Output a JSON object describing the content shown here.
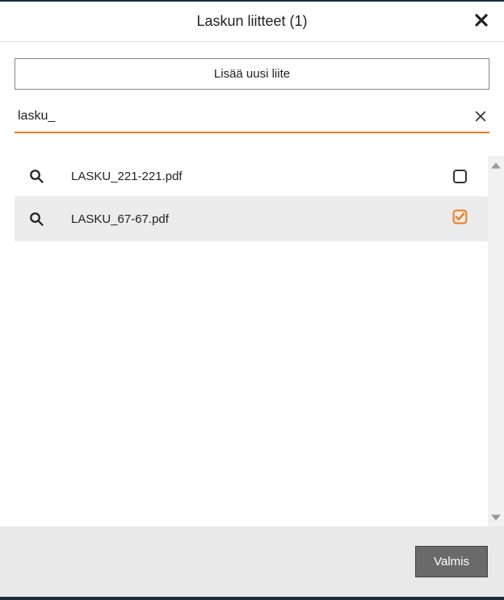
{
  "header": {
    "title": "Laskun liitteet (1)"
  },
  "actions": {
    "add_label": "Lisää uusi liite",
    "done_label": "Valmis"
  },
  "search": {
    "value": "lasku_"
  },
  "files": [
    {
      "name": "LASKU_221-221.pdf",
      "selected": false,
      "highlighted": false
    },
    {
      "name": "LASKU_67-67.pdf",
      "selected": true,
      "highlighted": true
    }
  ],
  "colors": {
    "accent": "#ee7d19"
  }
}
